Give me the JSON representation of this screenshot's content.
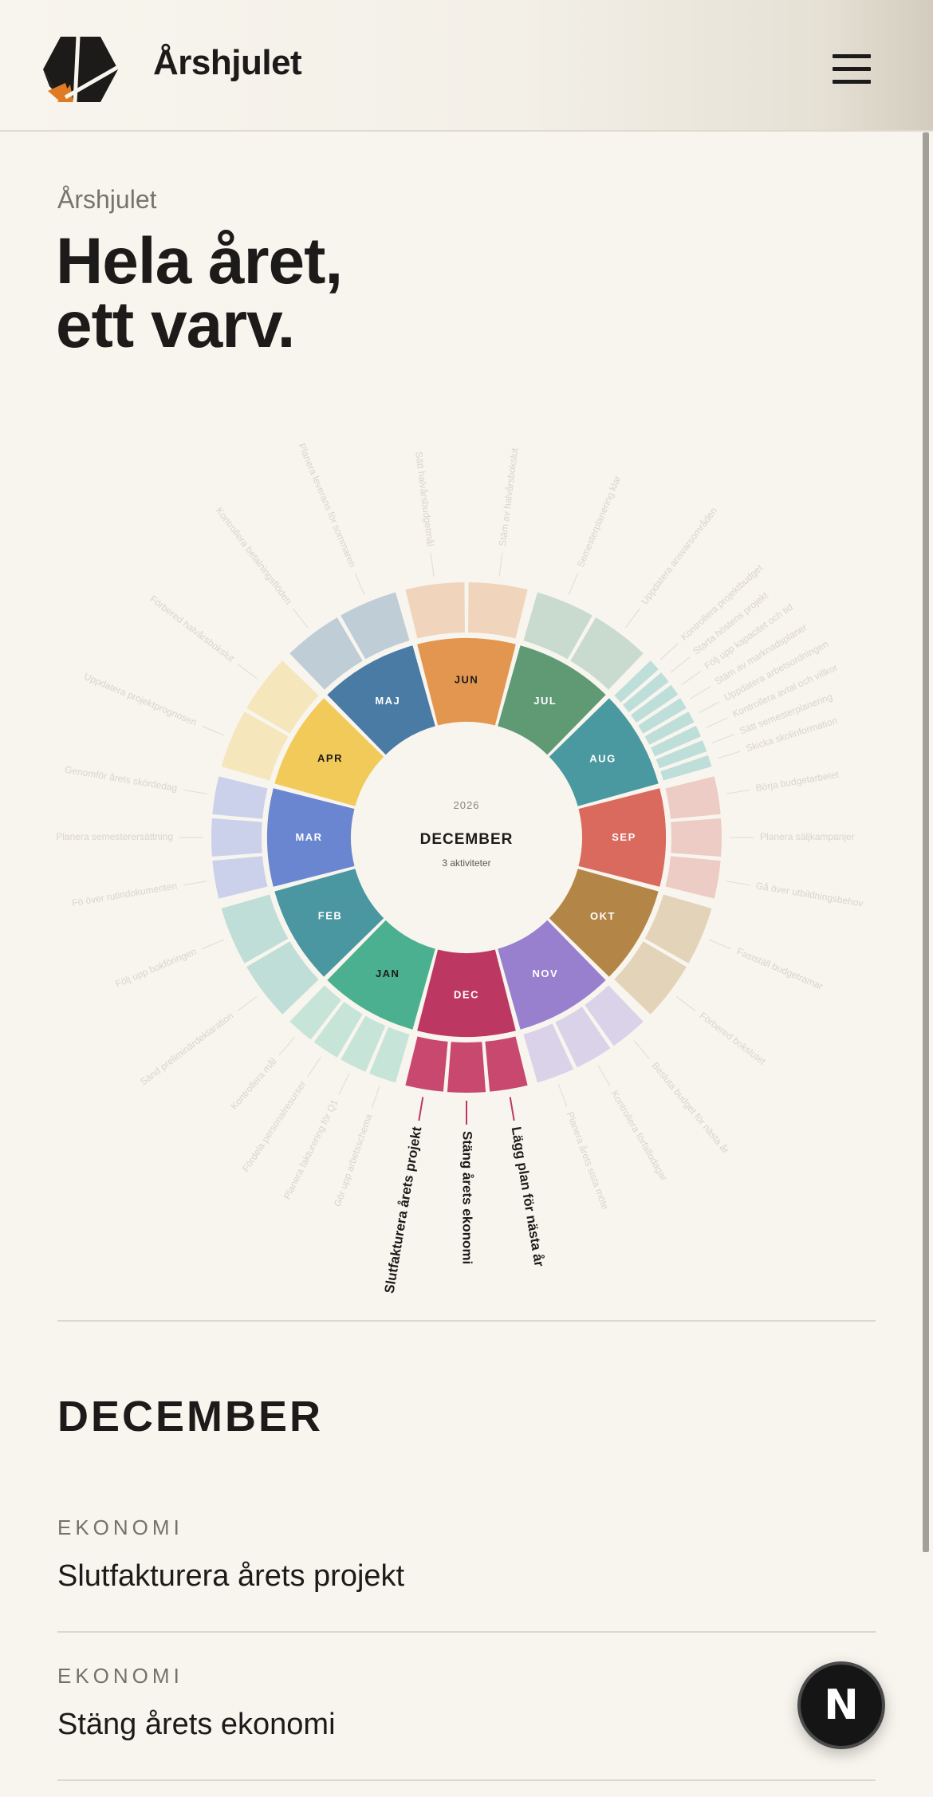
{
  "header": {
    "brand": "Årshjulet",
    "logo_icon": "hexagon-logo-icon",
    "menu_icon": "hamburger-menu-icon"
  },
  "hero": {
    "eyebrow": "Årshjulet",
    "headline_line1": "Hela året,",
    "headline_line2": "ett varv."
  },
  "wheel": {
    "year": "2026",
    "selected_month": "DECEMBER",
    "activity_count": "3 aktiviteter",
    "months": [
      {
        "label": "JAN",
        "color": "#4bb08f",
        "light": "#c4e3d6",
        "text": "#1c1b19",
        "activities": [
          "Gör upp arbetsschema",
          "Planera fakturering för Q1",
          "Fördela personalresurser",
          "Kontrollera mål"
        ]
      },
      {
        "label": "FEB",
        "color": "#4b97a1",
        "light": "#bcdcd5",
        "text": "#ffffff",
        "activities": [
          "Sänd preliminärdeklaration",
          "Följ upp bokföringen"
        ]
      },
      {
        "label": "MAR",
        "color": "#6a86d0",
        "light": "#c8cfe9",
        "text": "#ffffff",
        "activities": [
          "Fö över rutindokumenten",
          "Planera semesterersättning",
          "Genomför årets skördedag"
        ]
      },
      {
        "label": "APR",
        "color": "#f2ca5a",
        "light": "#f4e5b8",
        "text": "#1c1b19",
        "activities": [
          "Uppdatera projektprognosen",
          "Förbered halvårsbokslut"
        ]
      },
      {
        "label": "MAJ",
        "color": "#4a7ba5",
        "light": "#bccad5",
        "text": "#ffffff",
        "activities": [
          "Kontrollera betalningsflöden",
          "Planera leverans för sommaren"
        ]
      },
      {
        "label": "JUN",
        "color": "#e3964f",
        "light": "#efd3b8",
        "text": "#1c1b19",
        "activities": [
          "Sätt halvårsbudgetmål",
          "Stäm av halvårsbokslut"
        ]
      },
      {
        "label": "JUL",
        "color": "#5f9a75",
        "light": "#c6d9cb",
        "text": "#ffffff",
        "activities": [
          "Semesterplanering klar",
          "Uppdatera ansvarsområden"
        ]
      },
      {
        "label": "AUG",
        "color": "#4a98a0",
        "light": "#bbdcd8",
        "text": "#ffffff",
        "activities": [
          "Kontrollera projektbudget",
          "Starta höstens projekt",
          "Följ upp kapacitet och tid",
          "Stäm av marknadsplaner",
          "Uppdatera arbetsordningen",
          "Kontrollera avtal och villkor",
          "Sätt semesterplanering",
          "Skicka skolinformation"
        ]
      },
      {
        "label": "SEP",
        "color": "#d96a5d",
        "light": "#ebc9c1",
        "text": "#ffffff",
        "activities": [
          "Börja budgetarbetet",
          "Planera säljkampanjer",
          "Gå över utbildningsbehov"
        ]
      },
      {
        "label": "OKT",
        "color": "#b38546",
        "light": "#e1d1b5",
        "text": "#ffffff",
        "activities": [
          "Fastställ budgetramar",
          "Förbered bokslutet"
        ]
      },
      {
        "label": "NOV",
        "color": "#9880cf",
        "light": "#d8d0e8",
        "text": "#ffffff",
        "activities": [
          "Besluta budget för nästa år",
          "Kontrollera förfallodagar",
          "Planera årets sista möte"
        ]
      },
      {
        "label": "DEC",
        "color": "#bc3863",
        "light": "#c9486f",
        "text": "#ffffff",
        "activities": [
          "Lägg plan för nästa år",
          "Stäng årets ekonomi",
          "Slutfakturera årets projekt"
        ]
      }
    ]
  },
  "detail": {
    "month_title": "DECEMBER",
    "activities": [
      {
        "category": "EKONOMI",
        "title": "Slutfakturera årets projekt"
      },
      {
        "category": "EKONOMI",
        "title": "Stäng årets ekonomi"
      }
    ]
  },
  "fab": {
    "label": "N"
  }
}
